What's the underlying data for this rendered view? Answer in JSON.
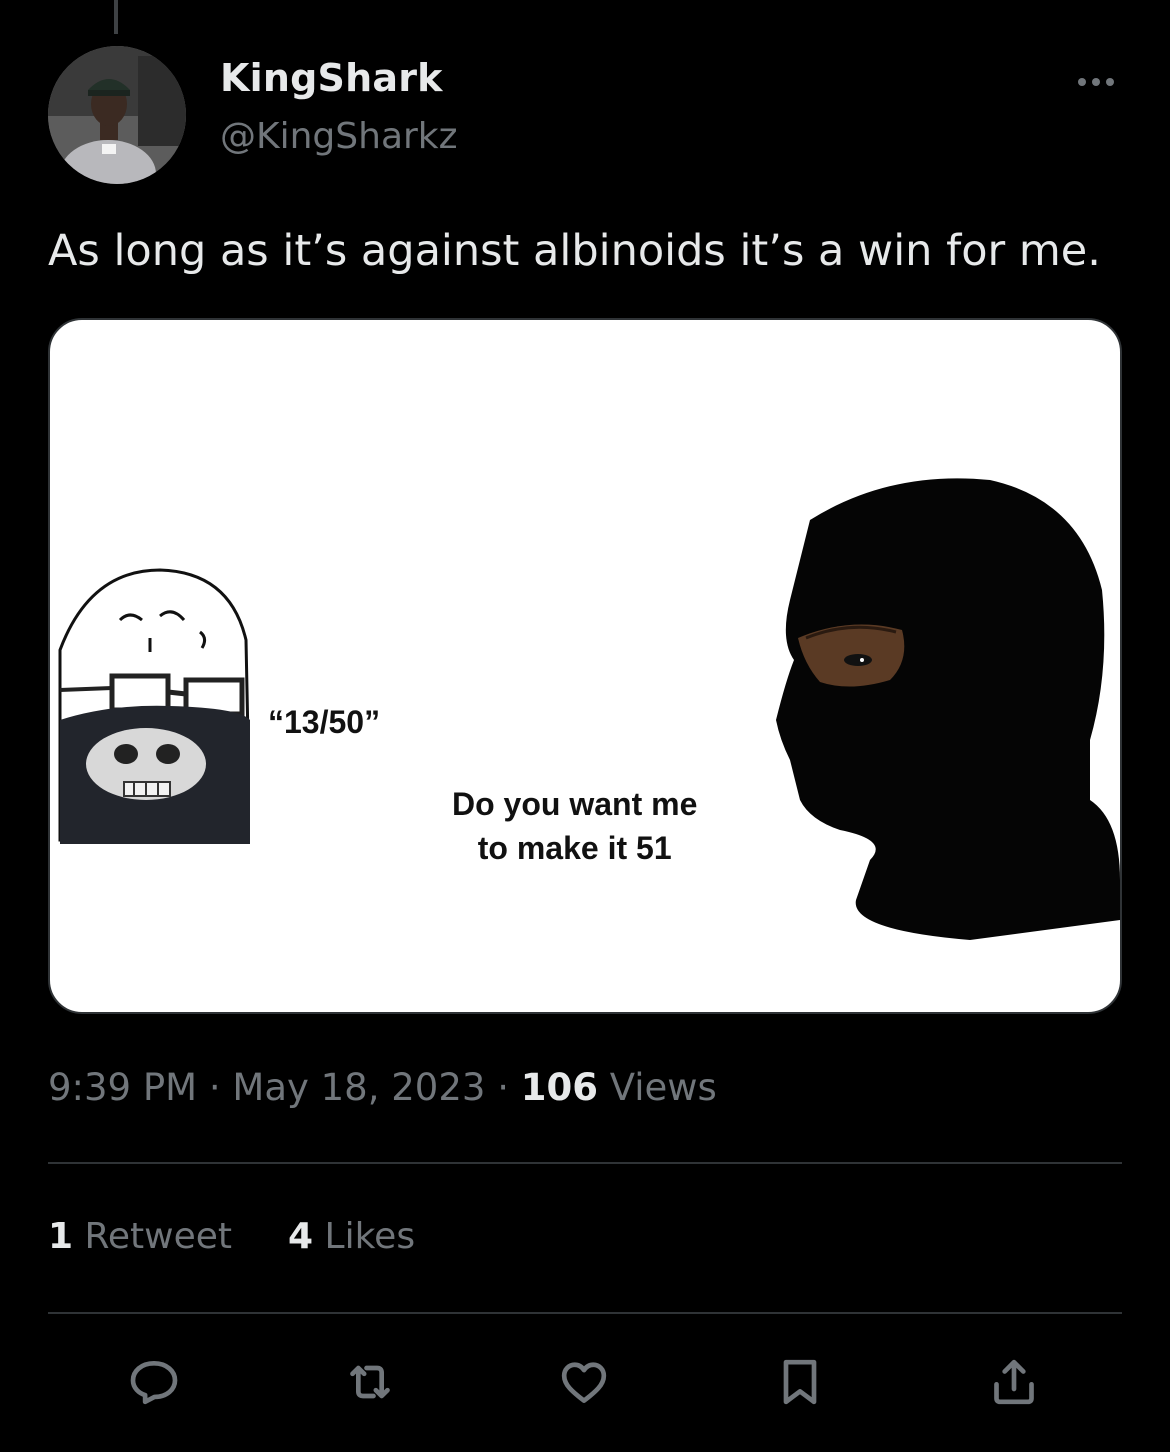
{
  "tweet": {
    "display_name": "KingShark",
    "handle": "@KingSharkz",
    "text": "As long as it’s against albinoids it’s a win for me.",
    "time": "9:39 PM",
    "separator": "·",
    "date": "May 18, 2023",
    "views_count": "106",
    "views_label": "Views"
  },
  "media": {
    "caption_left": "“13/50”",
    "caption_right_line1": "Do you want me",
    "caption_right_line2": "to make it 51"
  },
  "stats": {
    "retweets_count": "1",
    "retweets_label": "Retweet",
    "likes_count": "4",
    "likes_label": "Likes"
  },
  "icons": {
    "reply": "reply-icon",
    "retweet": "retweet-icon",
    "like": "heart-icon",
    "bookmark": "bookmark-icon",
    "share": "share-icon",
    "more": "more-options-icon"
  },
  "colors": {
    "background": "#000000",
    "primary_text": "#e7e9ea",
    "secondary_text": "#71767b",
    "divider": "#2f3336"
  }
}
